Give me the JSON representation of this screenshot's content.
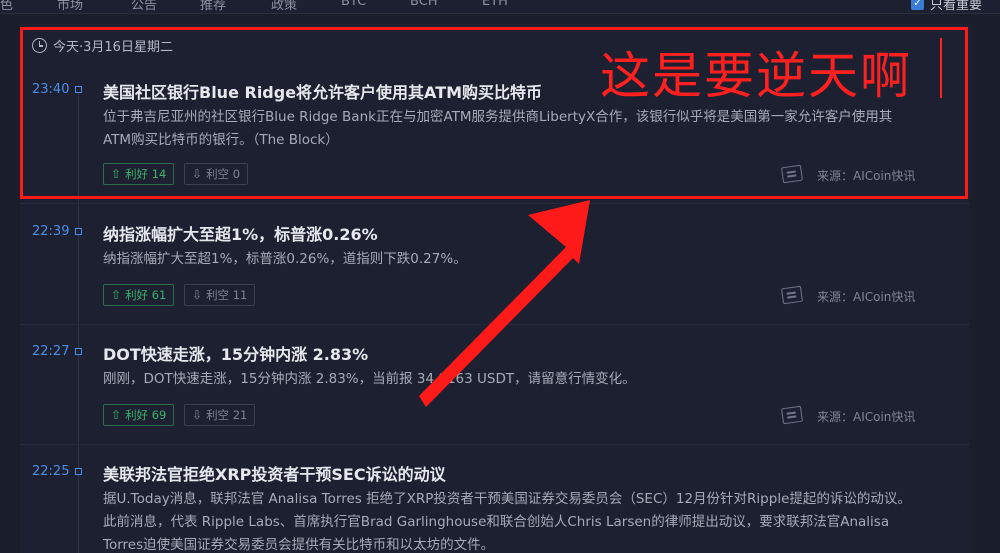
{
  "topnav": {
    "tabs": [
      "色",
      "市场",
      "公告",
      "推荐",
      "政策",
      "BTC",
      "BCH",
      "ETH"
    ],
    "only_important": "只看重要",
    "checkbox_mark": "✓"
  },
  "date_label": "今天·3月16日星期二",
  "items": [
    {
      "time": "23:40",
      "title": "美国社区银行Blue Ridge将允许客户使用其ATM购买比特币",
      "body": "位于弗吉尼亚州的社区银行Blue Ridge Bank正在与加密ATM服务提供商LibertyX合作，该银行似乎将是美国第一家允许客户使用其ATM购买比特币的银行。（The Block）",
      "good": "利好 14",
      "bad": "利空 0",
      "source": "来源：AICoin快讯"
    },
    {
      "time": "22:39",
      "title": "纳指涨幅扩大至超1%，标普涨0.26%",
      "body": "纳指涨幅扩大至超1%，标普涨0.26%，道指则下跌0.27%。",
      "good": "利好 61",
      "bad": "利空 11",
      "source": "来源：AICoin快讯"
    },
    {
      "time": "22:27",
      "title": "DOT快速走涨，15分钟内涨 2.83%",
      "body": "刚刚，DOT快速走涨，15分钟内涨 2.83%，当前报 34.8163 USDT，请留意行情变化。",
      "good": "利好 69",
      "bad": "利空 21",
      "source": "来源：AICoin快讯"
    },
    {
      "time": "22:25",
      "title": "美联邦法官拒绝XRP投资者干预SEC诉讼的动议",
      "body": "据U.Today消息，联邦法官 Analisa Torres 拒绝了XRP投资者干预美国证券交易委员会（SEC）12月份针对Ripple提起的诉讼的动议。此前消息，代表 Ripple Labs、首席执行官Brad Garlinghouse和联合创始人Chris Larsen的律师提出动议，要求联邦法官Analisa Torres迫使美国证券交易委员会提供有关比特币和以太坊的文件。"
    }
  ],
  "annotation": {
    "text": "这是要逆天啊",
    "color": "#ff2020"
  },
  "colors": {
    "accent": "#4b8ee8",
    "good": "#38b26a",
    "background": "#1a1d2a"
  }
}
